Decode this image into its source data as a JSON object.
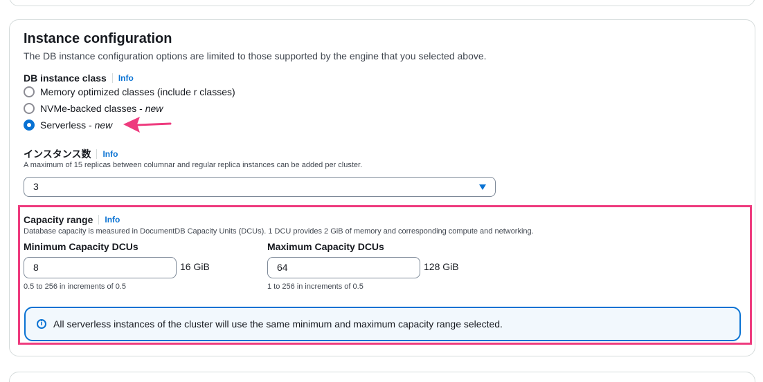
{
  "section": {
    "title": "Instance configuration",
    "subtitle": "The DB instance configuration options are limited to those supported by the engine that you selected above."
  },
  "db_instance_class": {
    "label": "DB instance class",
    "info": "Info",
    "options": [
      {
        "label": "Memory optimized classes (include r classes)",
        "suffix": "",
        "checked": false
      },
      {
        "label": "NVMe-backed classes - ",
        "suffix": "new",
        "checked": false
      },
      {
        "label": "Serverless - ",
        "suffix": "new",
        "checked": true
      }
    ]
  },
  "instance_count": {
    "label": "インスタンス数",
    "info": "Info",
    "description": "A maximum of 15 replicas between columnar and regular replica instances can be added per cluster.",
    "selected": "3"
  },
  "capacity_range": {
    "label": "Capacity range",
    "info": "Info",
    "description": "Database capacity is measured in DocumentDB Capacity Units (DCUs). 1 DCU provides 2 GiB of memory and corresponding compute and networking.",
    "min": {
      "label": "Minimum Capacity DCUs",
      "value": "8",
      "unit": "16 GiB",
      "hint": "0.5 to 256 in increments of 0.5"
    },
    "max": {
      "label": "Maximum Capacity DCUs",
      "value": "64",
      "unit": "128 GiB",
      "hint": "1 to 256 in increments of 0.5"
    },
    "alert": "All serverless instances of the cluster will use the same minimum and maximum capacity range selected."
  },
  "colors": {
    "accent": "#0972d3",
    "annotation": "#ee3b7e"
  }
}
